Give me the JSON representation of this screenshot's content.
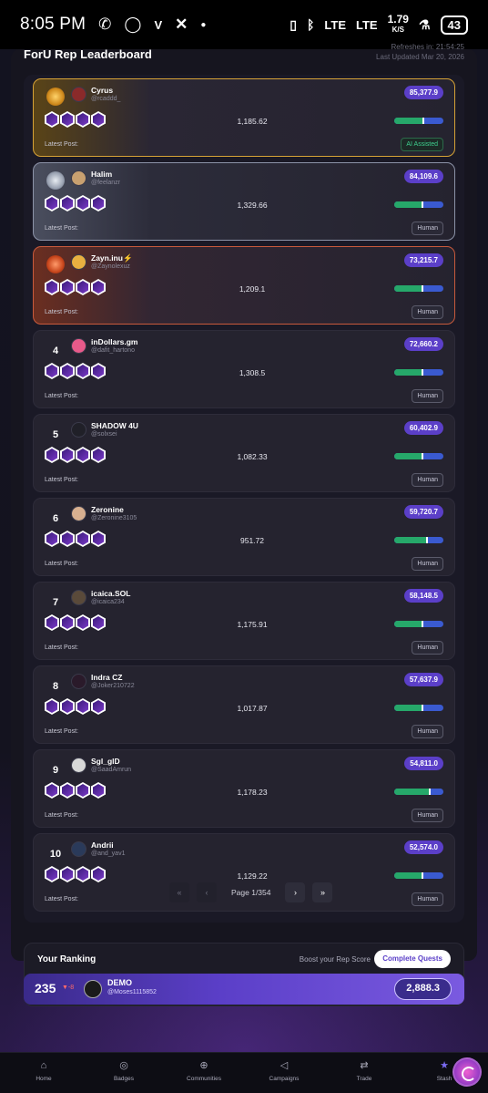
{
  "status_bar": {
    "time": "8:05 PM",
    "left_icons": [
      "whatsapp-icon",
      "ring-icon",
      "vpn-icon",
      "x-icon",
      "dot-icon"
    ],
    "network1": "LTE",
    "network2": "LTE",
    "speed_value": "1.79",
    "speed_unit": "K/S",
    "battery": "43"
  },
  "header": {
    "title": "ForU Rep Leaderboard",
    "refresh_text": "Refreshes in: 21:54:25",
    "last_updated": "Last Updated Mar 20, 2026"
  },
  "leaderboard": {
    "latest_post_label": "Latest Post:",
    "rows": [
      {
        "rank": "1",
        "tier": "gold",
        "name": "Cyrus",
        "handle": "@rcaddd_",
        "score": "85,377.9",
        "metric": "1,185.62",
        "bar": 0.58,
        "tag": "AI Assisted",
        "tag_type": "ai",
        "avatar_color": "#8a2a2a"
      },
      {
        "rank": "2",
        "tier": "silver",
        "name": "Halim",
        "handle": "@feelanzr",
        "score": "84,109.6",
        "metric": "1,329.66",
        "bar": 0.56,
        "tag": "Human",
        "tag_type": "human",
        "avatar_color": "#c8a070"
      },
      {
        "rank": "3",
        "tier": "bronze",
        "name": "Zayn.inu⚡",
        "handle": "@Zaynolexuz",
        "score": "73,215.7",
        "metric": "1,209.1",
        "bar": 0.55,
        "tag": "Human",
        "tag_type": "human",
        "avatar_color": "#e8b040"
      },
      {
        "rank": "4",
        "tier": "",
        "name": "inDollars.gm",
        "handle": "@dafit_hartono",
        "score": "72,660.2",
        "metric": "1,308.5",
        "bar": 0.55,
        "tag": "Human",
        "tag_type": "human",
        "avatar_color": "#e85a8a"
      },
      {
        "rank": "5",
        "tier": "",
        "name": "SHADOW 4U",
        "handle": "@solxsei",
        "score": "60,402.9",
        "metric": "1,082.33",
        "bar": 0.55,
        "tag": "Human",
        "tag_type": "human",
        "avatar_color": "#202028"
      },
      {
        "rank": "6",
        "tier": "",
        "name": "Zeronine",
        "handle": "@Zeronine3105",
        "score": "59,720.7",
        "metric": "951.72",
        "bar": 0.65,
        "tag": "Human",
        "tag_type": "human",
        "avatar_color": "#d8b090"
      },
      {
        "rank": "7",
        "tier": "",
        "name": "icaica.SOL",
        "handle": "@icaica234",
        "score": "58,148.5",
        "metric": "1,175.91",
        "bar": 0.55,
        "tag": "Human",
        "tag_type": "human",
        "avatar_color": "#5a4a3a"
      },
      {
        "rank": "8",
        "tier": "",
        "name": "Indra CZ",
        "handle": "@Joker210722",
        "score": "57,637.9",
        "metric": "1,017.87",
        "bar": 0.55,
        "tag": "Human",
        "tag_type": "human",
        "avatar_color": "#2a1a2a"
      },
      {
        "rank": "9",
        "tier": "",
        "name": "Sgl_glD",
        "handle": "@SaadAmrun",
        "score": "54,811.0",
        "metric": "1,178.23",
        "bar": 0.7,
        "tag": "Human",
        "tag_type": "human",
        "avatar_color": "#d8d8d8"
      },
      {
        "rank": "10",
        "tier": "",
        "name": "Andrii",
        "handle": "@and_yav1",
        "score": "52,574.0",
        "metric": "1,129.22",
        "bar": 0.55,
        "tag": "Human",
        "tag_type": "human",
        "avatar_color": "#2a3a5a"
      }
    ]
  },
  "pagination": {
    "first": "«",
    "prev": "‹",
    "label": "Page 1/354",
    "next": "›",
    "last": "»"
  },
  "your_ranking": {
    "title": "Your Ranking",
    "boost_text": "Boost your Rep Score",
    "button_label": "Complete Quests",
    "rank": "235",
    "delta": "▼-8",
    "name": "DEMO",
    "handle": "@Moses1115852",
    "score": "2,888.3"
  },
  "bottom_nav": {
    "items": [
      {
        "label": "Home",
        "icon": "home-icon",
        "glyph": "⌂"
      },
      {
        "label": "Badges",
        "icon": "badge-icon",
        "glyph": "◎"
      },
      {
        "label": "Communities",
        "icon": "globe-icon",
        "glyph": "⊕"
      },
      {
        "label": "Campaigns",
        "icon": "megaphone-icon",
        "glyph": "◁"
      },
      {
        "label": "Trade",
        "icon": "swap-icon",
        "glyph": "⇄"
      },
      {
        "label": "Stash",
        "icon": "star-icon",
        "glyph": "★"
      }
    ]
  }
}
